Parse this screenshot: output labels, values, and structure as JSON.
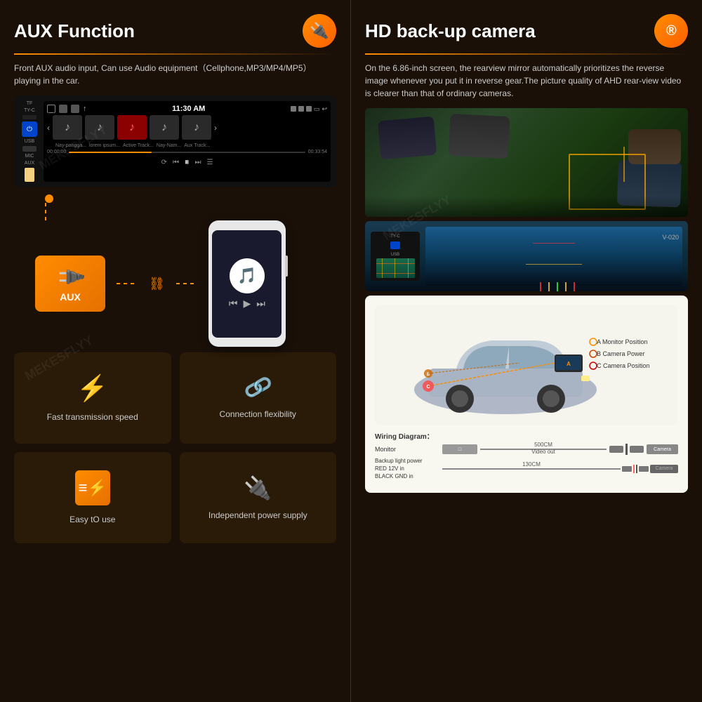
{
  "left": {
    "title": "AUX Function",
    "icon": "🔌",
    "description": "Front AUX audio input, Can use Audio equipment（Cellphone,MP3/MP4/MP5）playing in the car.",
    "stereo": {
      "time": "11:30 AM",
      "tracks": [
        "♪",
        "♪",
        "♪",
        "♪",
        "♪"
      ],
      "activeTrack": 2
    },
    "aux_label": "AUX",
    "features": [
      {
        "icon": "⚡",
        "label": "Fast transmission speed",
        "type": "lightning"
      },
      {
        "icon": "🔗",
        "label": "Connection flexibility",
        "type": "link"
      },
      {
        "icon": "≡",
        "label": "Easy tO use",
        "type": "stack"
      },
      {
        "icon": "⚡",
        "label": "Independent power supply",
        "type": "plug"
      }
    ]
  },
  "right": {
    "title": "HD back-up camera",
    "icon": "®",
    "description": "On the 6.86-inch screen, the rearview mirror automatically prioritizes the reverse image whenever you put it in reverse gear.The picture quality of AHD rear-view video is clearer than that of ordinary cameras.",
    "wiring": {
      "title": "Wiring Diagram：",
      "distance_video": "500CM",
      "distance_backup": "130CM",
      "monitor_label": "Monitor",
      "camera_label": "Camera",
      "video_label": "Video out",
      "backup_power_label": "Backup light power",
      "red_label": "RED  12V in",
      "black_label": "BLACK GND in",
      "legend": [
        {
          "key": "A",
          "label": "Monitor Position",
          "color": "#ff8c00"
        },
        {
          "key": "B",
          "label": "Camera Power",
          "color": "#cc4400"
        },
        {
          "key": "C",
          "label": "Camera Position",
          "color": "#cc0000"
        }
      ]
    }
  }
}
